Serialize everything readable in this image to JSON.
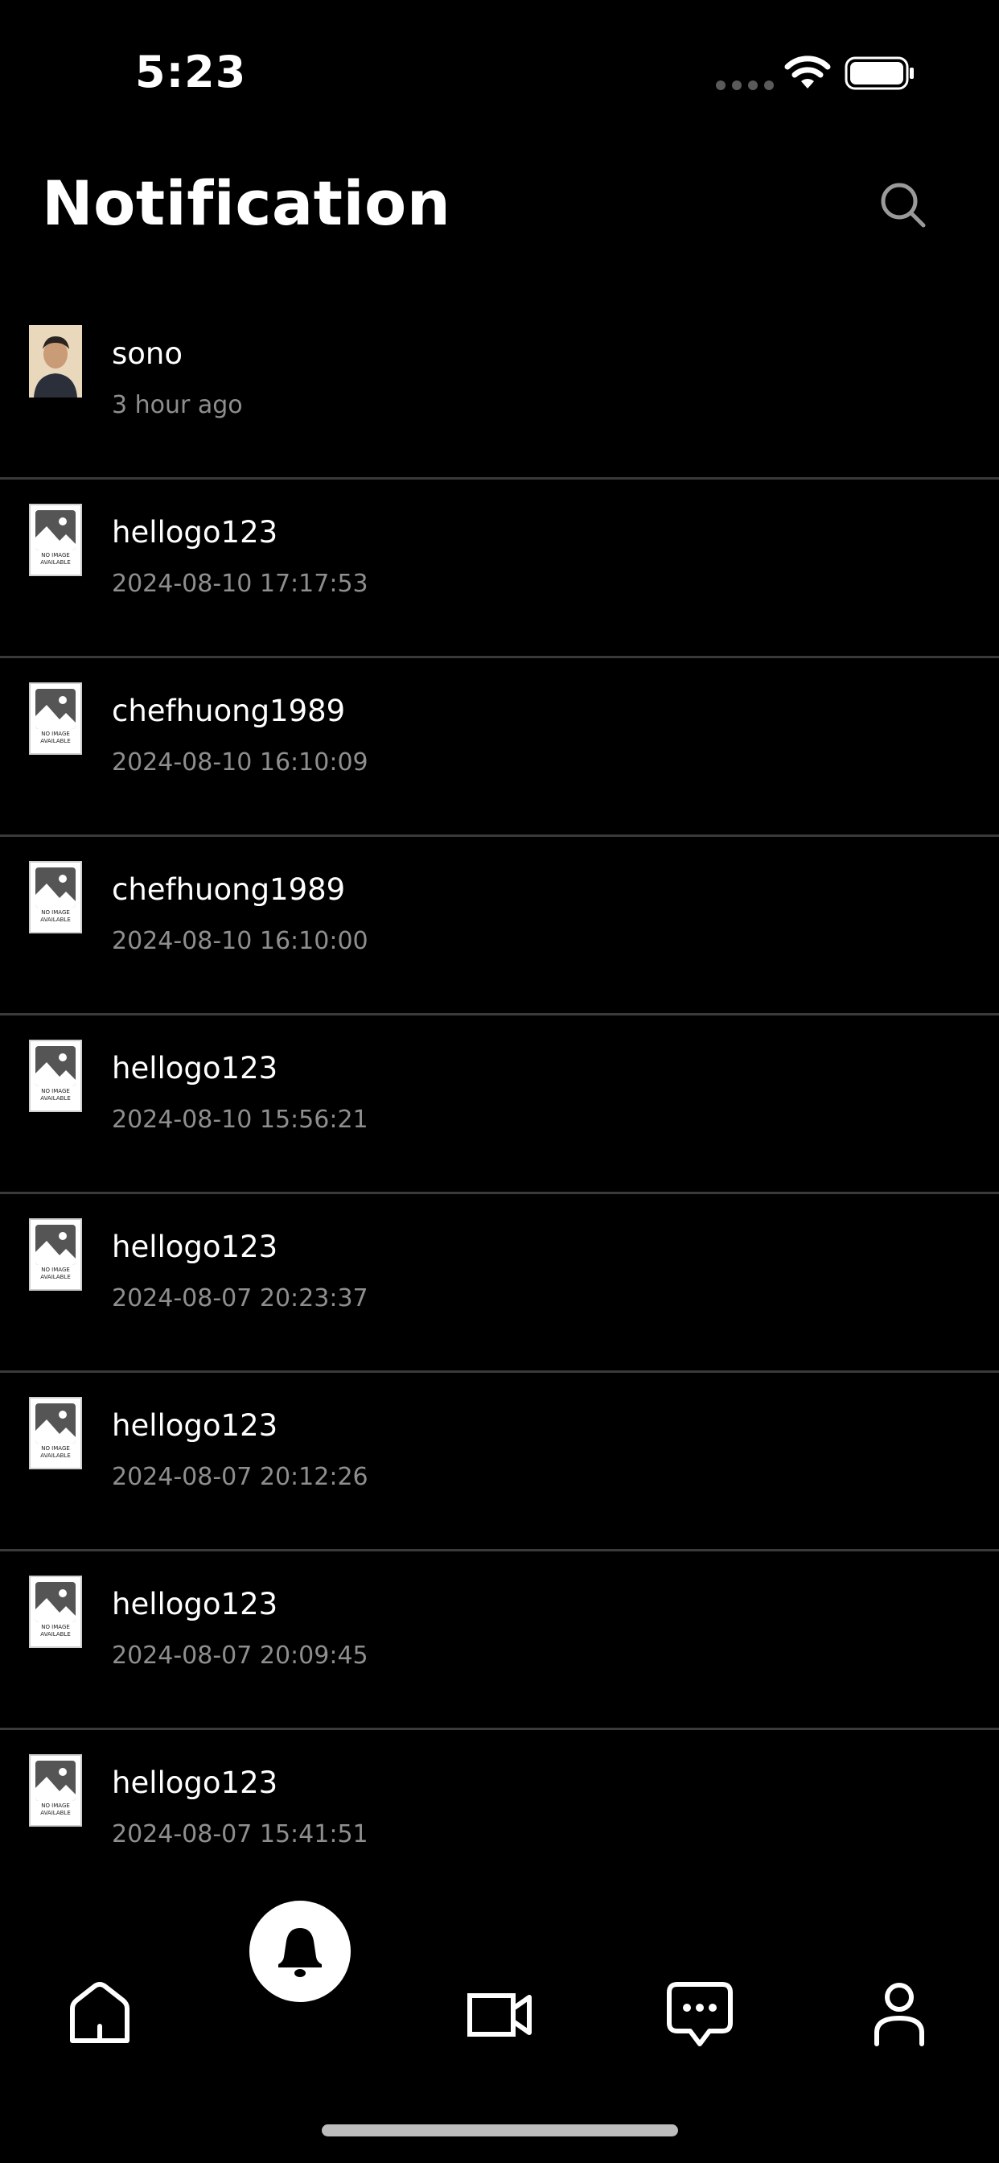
{
  "status_bar": {
    "time": "5:23"
  },
  "header": {
    "title": "Notification",
    "search_icon": "search-icon"
  },
  "colors": {
    "background": "#000000",
    "text_primary": "#ffffff",
    "text_secondary": "#8e8e8e",
    "divider": "#3a3a3a"
  },
  "notifications": [
    {
      "name": "sono",
      "time": "3 hour ago",
      "thumb": "avatar"
    },
    {
      "name": "hellogo123",
      "time": "2024-08-10 17:17:53",
      "thumb": "no-image"
    },
    {
      "name": "chefhuong1989",
      "time": "2024-08-10 16:10:09",
      "thumb": "no-image"
    },
    {
      "name": "chefhuong1989",
      "time": "2024-08-10 16:10:00",
      "thumb": "no-image"
    },
    {
      "name": "hellogo123",
      "time": "2024-08-10 15:56:21",
      "thumb": "no-image"
    },
    {
      "name": "hellogo123",
      "time": "2024-08-07 20:23:37",
      "thumb": "no-image"
    },
    {
      "name": "hellogo123",
      "time": "2024-08-07 20:12:26",
      "thumb": "no-image"
    },
    {
      "name": "hellogo123",
      "time": "2024-08-07 20:09:45",
      "thumb": "no-image"
    },
    {
      "name": "hellogo123",
      "time": "2024-08-07 15:41:51",
      "thumb": "no-image"
    }
  ],
  "no_image": {
    "line1": "NO IMAGE",
    "line2": "AVAILABLE"
  },
  "bottom_nav": {
    "items": [
      "home-icon",
      "bell-icon",
      "video-icon",
      "chat-icon",
      "profile-icon"
    ],
    "active": "bell-icon"
  }
}
